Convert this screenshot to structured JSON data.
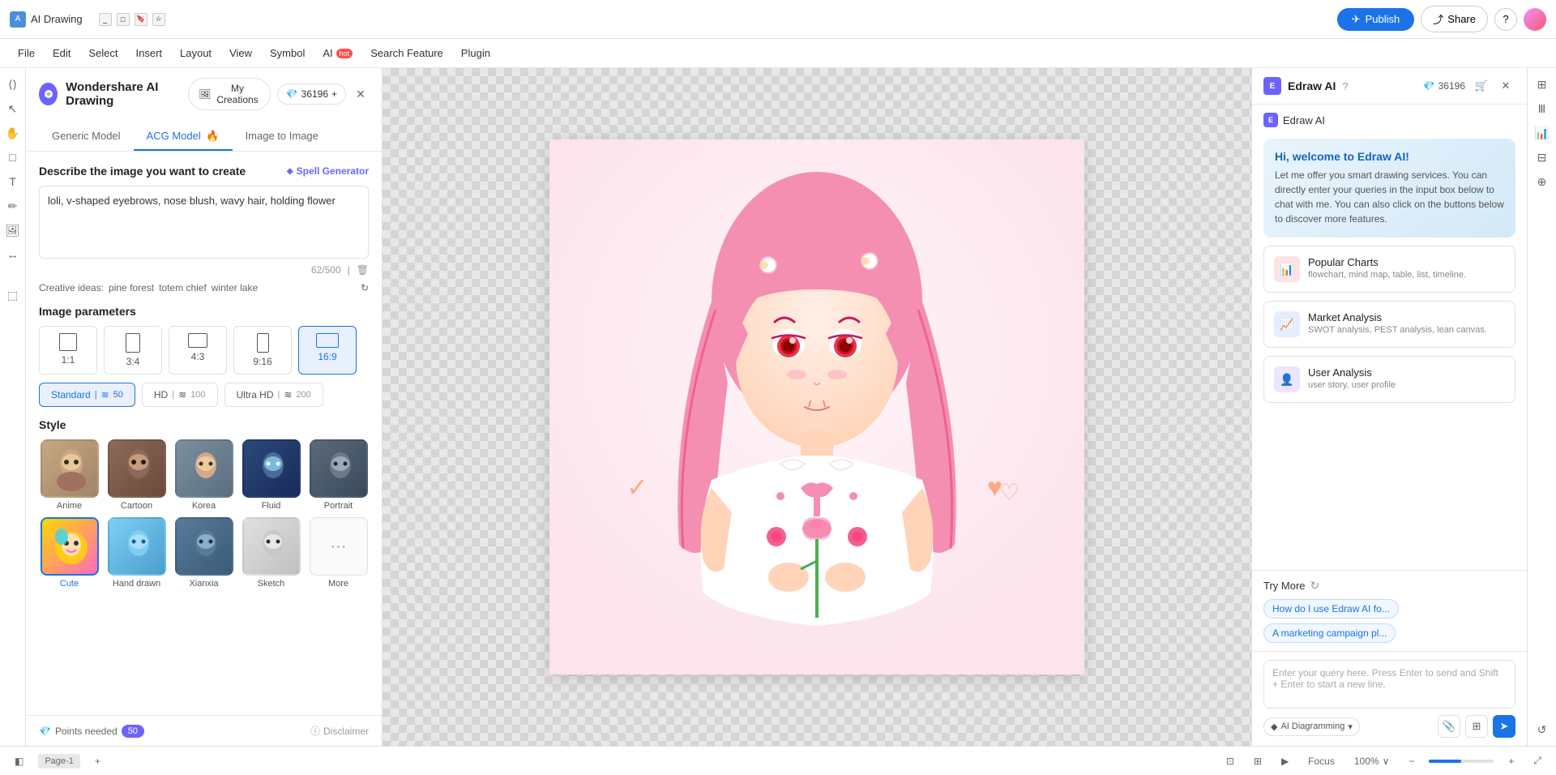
{
  "app": {
    "title": "AI Drawing",
    "logo_char": "A"
  },
  "topbar": {
    "publish_label": "Publish",
    "share_label": "Share",
    "menu_items": [
      "File",
      "Edit",
      "Select",
      "Insert",
      "Layout",
      "View",
      "Symbol",
      "AI",
      "Search Feature",
      "Plugin"
    ],
    "ai_label": "AI",
    "hot_badge": "hot",
    "credits": "36196"
  },
  "panel": {
    "title": "Wondershare AI Drawing",
    "my_creations_label": "My Creations",
    "credits_label": "36196",
    "tabs": [
      {
        "id": "generic",
        "label": "Generic Model",
        "active": false
      },
      {
        "id": "acg",
        "label": "ACG Model",
        "active": true,
        "fire": true
      },
      {
        "id": "img2img",
        "label": "Image to Image",
        "active": false
      }
    ],
    "describe_title": "Describe the image you want to create",
    "spell_generator": "Spell Generator",
    "prompt_text": "loli, v-shaped eyebrows, nose blush, wavy hair, holding flower",
    "char_count": "62/500",
    "creative_ideas_label": "Creative ideas:",
    "creative_ideas": [
      "pine forest",
      "totem chief",
      "winter lake"
    ],
    "params_title": "Image parameters",
    "ratios": [
      {
        "id": "1:1",
        "label": "1:1",
        "active": false
      },
      {
        "id": "3:4",
        "label": "3:4",
        "active": false
      },
      {
        "id": "4:3",
        "label": "4:3",
        "active": false
      },
      {
        "id": "9:16",
        "label": "9:16",
        "active": false
      },
      {
        "id": "16:9",
        "label": "16:9",
        "active": true
      }
    ],
    "quality_options": [
      {
        "label": "Standard",
        "cost": "50",
        "active": true
      },
      {
        "label": "HD",
        "cost": "100",
        "active": false
      },
      {
        "label": "Ultra HD",
        "cost": "200",
        "active": false
      }
    ],
    "style_title": "Style",
    "styles": [
      {
        "id": "anime",
        "label": "Anime",
        "active": false,
        "color": "style-color-1"
      },
      {
        "id": "cartoon",
        "label": "Cartoon",
        "active": false,
        "color": "style-color-2"
      },
      {
        "id": "korea",
        "label": "Korea",
        "active": false,
        "color": "style-color-3"
      },
      {
        "id": "fluid",
        "label": "Fluid",
        "active": false,
        "color": "style-color-4"
      },
      {
        "id": "portrait",
        "label": "Portrait",
        "active": false,
        "color": "style-color-5"
      },
      {
        "id": "cute",
        "label": "Cute",
        "active": true,
        "color": "style-color-cute"
      },
      {
        "id": "hand_drawn",
        "label": "Hand drawn",
        "active": false,
        "color": "style-color-6"
      },
      {
        "id": "xianxia",
        "label": "Xianxia",
        "active": false,
        "color": "style-color-7"
      },
      {
        "id": "sketch",
        "label": "Sketch",
        "active": false,
        "color": "style-color-8"
      }
    ],
    "more_label": "More",
    "points_label": "Points needed",
    "points_value": "50",
    "disclaimer_label": "Disclaimer"
  },
  "right_panel": {
    "title": "Edraw AI",
    "subtitle": "Edraw AI",
    "credits": "36196",
    "welcome_title": "Hi, welcome to Edraw AI!",
    "welcome_text": "Let me offer you smart drawing services. You can directly enter your queries in the input box below to chat with me. You can also click on the buttons below to discover more features.",
    "features": [
      {
        "id": "popular-charts",
        "name": "Popular Charts",
        "desc": "flowchart,  mind map,  table,  list, timeline.",
        "icon": "📊",
        "color": "red"
      },
      {
        "id": "market-analysis",
        "name": "Market Analysis",
        "desc": "SWOT analysis,  PEST analysis,  lean canvas.",
        "icon": "📈",
        "color": "blue"
      },
      {
        "id": "user-analysis",
        "name": "User Analysis",
        "desc": "user story,  user profile",
        "icon": "👤",
        "color": "purple"
      }
    ],
    "try_more_label": "Try More",
    "try_more_chips": [
      "How do I use Edraw AI fo...",
      "A marketing campaign pl..."
    ],
    "input_placeholder": "Enter your query here. Press Enter to send and Shift + Enter to start a new line.",
    "ai_diagramming_label": "AI Diagramming"
  },
  "statusbar": {
    "page_label": "Page-1",
    "focus_label": "Focus",
    "zoom_label": "100%"
  }
}
